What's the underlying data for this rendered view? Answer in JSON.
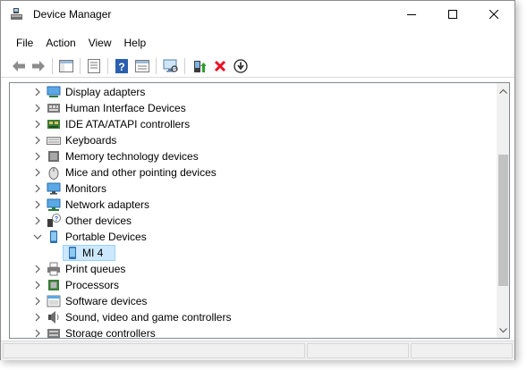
{
  "window": {
    "title": "Device Manager"
  },
  "menu": {
    "items": [
      "File",
      "Action",
      "View",
      "Help"
    ]
  },
  "toolbar": {
    "buttons": [
      "back-icon",
      "forward-icon",
      "show-hide-console-tree-icon",
      "properties-icon",
      "help-icon",
      "view-icon",
      "scan-hardware-icon",
      "update-driver-icon",
      "uninstall-icon",
      "disable-device-icon"
    ]
  },
  "tree": {
    "nodes": [
      {
        "label": "Display adapters",
        "expanded": false,
        "icon": "display-adapter-icon"
      },
      {
        "label": "Human Interface Devices",
        "expanded": false,
        "icon": "hid-icon"
      },
      {
        "label": "IDE ATA/ATAPI controllers",
        "expanded": false,
        "icon": "ide-controller-icon"
      },
      {
        "label": "Keyboards",
        "expanded": false,
        "icon": "keyboard-icon"
      },
      {
        "label": "Memory technology devices",
        "expanded": false,
        "icon": "memory-icon"
      },
      {
        "label": "Mice and other pointing devices",
        "expanded": false,
        "icon": "mouse-icon"
      },
      {
        "label": "Monitors",
        "expanded": false,
        "icon": "monitor-icon"
      },
      {
        "label": "Network adapters",
        "expanded": false,
        "icon": "network-adapter-icon"
      },
      {
        "label": "Other devices",
        "expanded": false,
        "icon": "unknown-device-icon"
      },
      {
        "label": "Portable Devices",
        "expanded": true,
        "icon": "portable-device-icon"
      },
      {
        "label": "MI 4",
        "child": true,
        "selected": true,
        "icon": "phone-icon"
      },
      {
        "label": "Print queues",
        "expanded": false,
        "icon": "printer-icon"
      },
      {
        "label": "Processors",
        "expanded": false,
        "icon": "processor-icon"
      },
      {
        "label": "Software devices",
        "expanded": false,
        "icon": "software-device-icon"
      },
      {
        "label": "Sound, video and game controllers",
        "expanded": false,
        "icon": "speaker-icon"
      },
      {
        "label": "Storage controllers",
        "expanded": false,
        "icon": "storage-controller-icon"
      }
    ]
  },
  "colors": {
    "selection_fill": "#cce8ff",
    "selection_border": "#99d1ff",
    "uninstall_red": "#e81123",
    "scan_green": "#2e9d2e"
  }
}
